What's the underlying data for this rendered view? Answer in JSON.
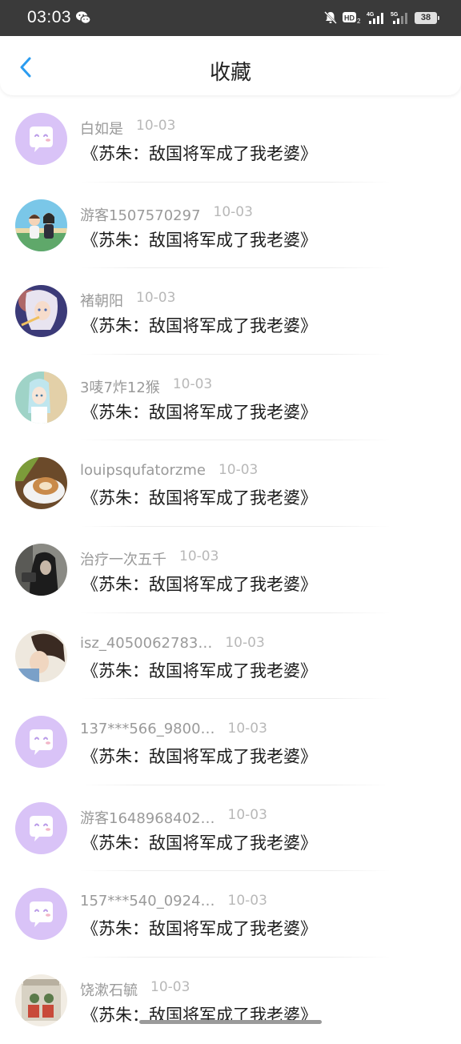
{
  "status_bar": {
    "time": "03:03",
    "battery": "38",
    "icons": [
      "wechat-icon",
      "mute-icon",
      "hd-icon",
      "4g-signal-icon",
      "5g-signal-icon",
      "battery-icon"
    ]
  },
  "header": {
    "title": "收藏",
    "back_icon": "chevron-left-icon",
    "accent_color": "#2b9cf0"
  },
  "favorites": [
    {
      "username": "白如是",
      "date": "10-03",
      "book_title": "《苏朱：敌国将军成了我老婆》",
      "avatar": "default-chat"
    },
    {
      "username": "游客1507570297",
      "date": "10-03",
      "book_title": "《苏朱：敌国将军成了我老婆》",
      "avatar": "anime-couple"
    },
    {
      "username": "褚朝阳",
      "date": "10-03",
      "book_title": "《苏朱：敌国将军成了我老婆》",
      "avatar": "anime-character"
    },
    {
      "username": "3唛7炸12猴",
      "date": "10-03",
      "book_title": "《苏朱：敌国将军成了我老婆》",
      "avatar": "anime-girl"
    },
    {
      "username": "louipsqufatorzme",
      "date": "10-03",
      "book_title": "《苏朱：敌国将军成了我老婆》",
      "avatar": "coffee-cup"
    },
    {
      "username": "治疗一次五千",
      "date": "10-03",
      "book_title": "《苏朱：敌国将军成了我老婆》",
      "avatar": "hooded-figure"
    },
    {
      "username": "isz_4050062783…",
      "date": "10-03",
      "book_title": "《苏朱：敌国将军成了我老婆》",
      "avatar": "person-photo"
    },
    {
      "username": "137***566_9800…",
      "date": "10-03",
      "book_title": "《苏朱：敌国将军成了我老婆》",
      "avatar": "default-chat"
    },
    {
      "username": "游客1648968402…",
      "date": "10-03",
      "book_title": "《苏朱：敌国将军成了我老婆》",
      "avatar": "default-chat"
    },
    {
      "username": "157***540_0924…",
      "date": "10-03",
      "book_title": "《苏朱：敌国将军成了我老婆》",
      "avatar": "default-chat"
    },
    {
      "username": "饶漱石毓",
      "date": "10-03",
      "book_title": "《苏朱：敌国将军成了我老婆》",
      "avatar": "poster-art"
    }
  ]
}
